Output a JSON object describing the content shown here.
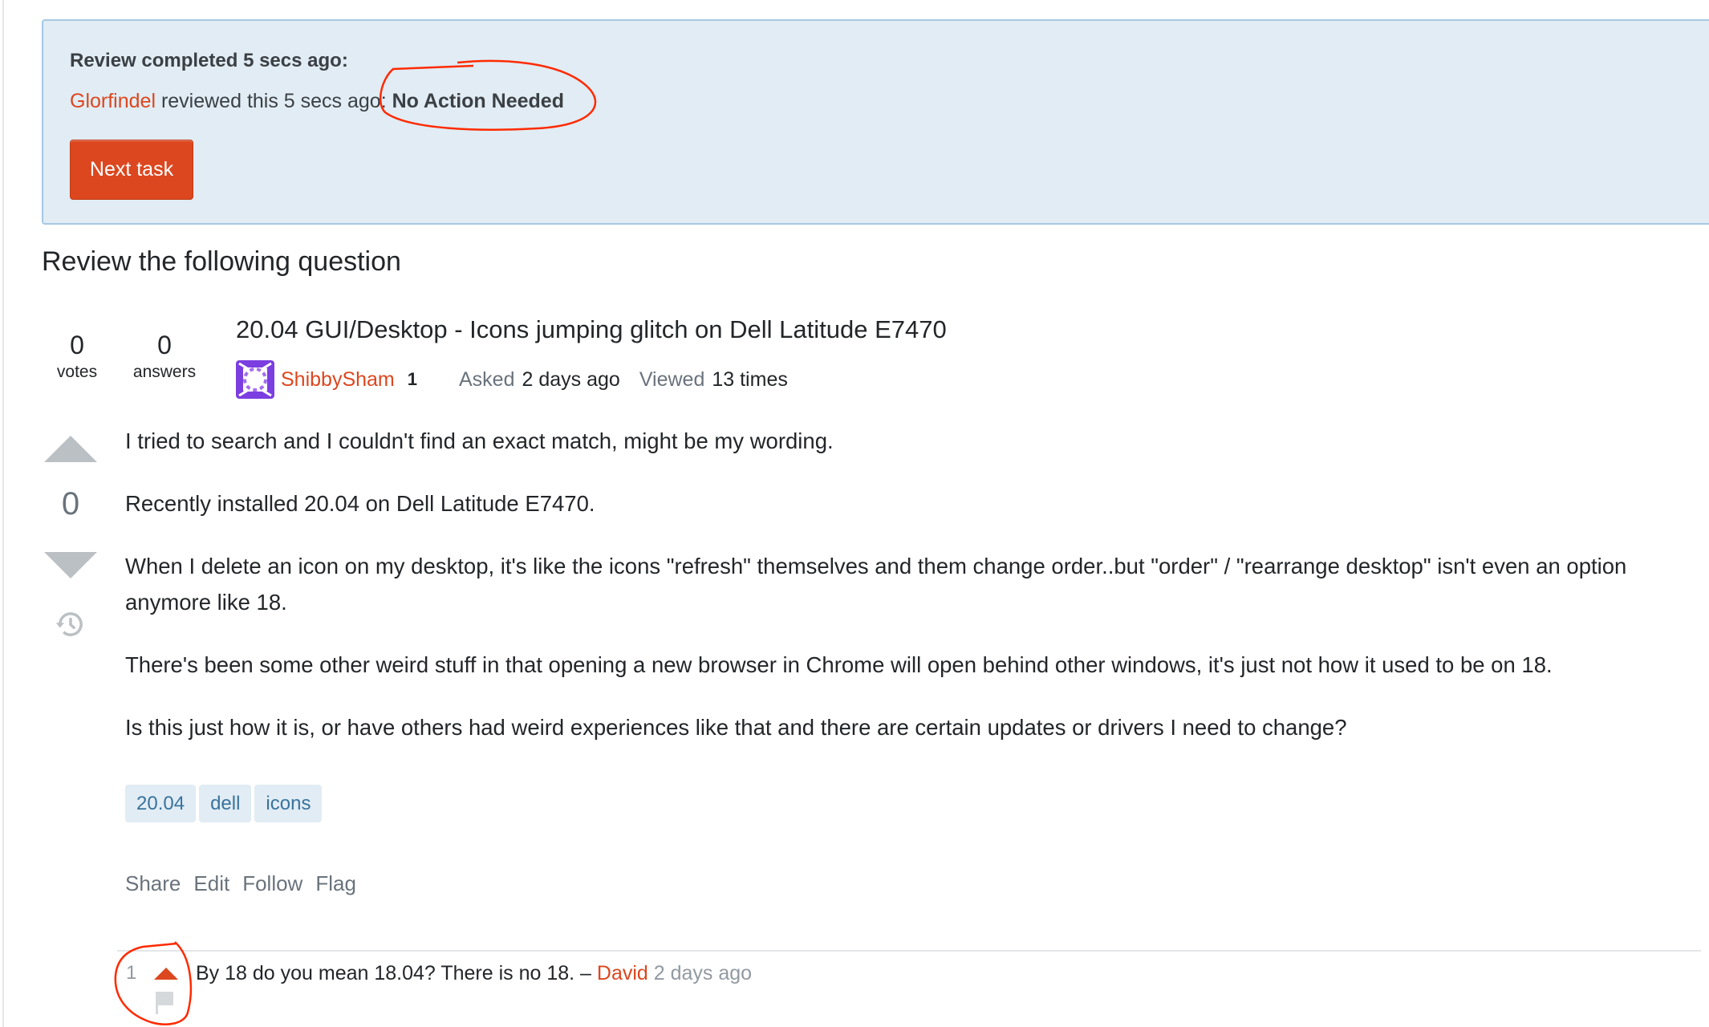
{
  "notice": {
    "title": "Review completed 5 secs ago:",
    "reviewer": "Glorfindel",
    "reviewed_text": " reviewed this 5 secs ago: ",
    "outcome": "No Action Needed",
    "next_button": "Next task"
  },
  "section_heading": "Review the following question",
  "question": {
    "votes": "0",
    "votes_label": "votes",
    "answers": "0",
    "answers_label": "answers",
    "title": "20.04 GUI/Desktop - Icons jumping glitch on Dell Latitude E7470",
    "author": "ShibbySham",
    "author_rep": "1",
    "asked_label": "Asked",
    "asked_value": "2 days ago",
    "viewed_label": "Viewed",
    "viewed_value": "13 times",
    "score": "0",
    "body": [
      "I tried to search and I couldn't find an exact match, might be my wording.",
      "Recently installed 20.04 on Dell Latitude E7470.",
      "When I delete an icon on my desktop, it's like the icons \"refresh\" themselves and them change order..but \"order\" / \"rearrange desktop\" isn't even an option anymore like 18.",
      "There's been some other weird stuff in that opening a new browser in Chrome will open behind other windows, it's just not how it used to be on 18.",
      "Is this just how it is, or have others had weird experiences like that and there are certain updates or drivers I need to change?"
    ],
    "tags": [
      "20.04",
      "dell",
      "icons"
    ],
    "menu": [
      "Share",
      "Edit",
      "Follow",
      "Flag"
    ]
  },
  "comment": {
    "score": "1",
    "text": "By 18 do you mean 18.04? There is no 18. – ",
    "user": "David",
    "date": " 2 days ago"
  },
  "icons": {
    "vote_up": "triangle-up",
    "vote_down": "triangle-down",
    "history": "history-clock",
    "comment_upvote": "triangle-up",
    "comment_flag": "flag"
  },
  "colors": {
    "accent": "#dc471f",
    "notice_bg": "#e1ecf4",
    "notice_border": "#a6c8e4",
    "tag_bg": "#e1ecf4",
    "tag_text": "#39739d",
    "annotation": "#ff2a00"
  }
}
